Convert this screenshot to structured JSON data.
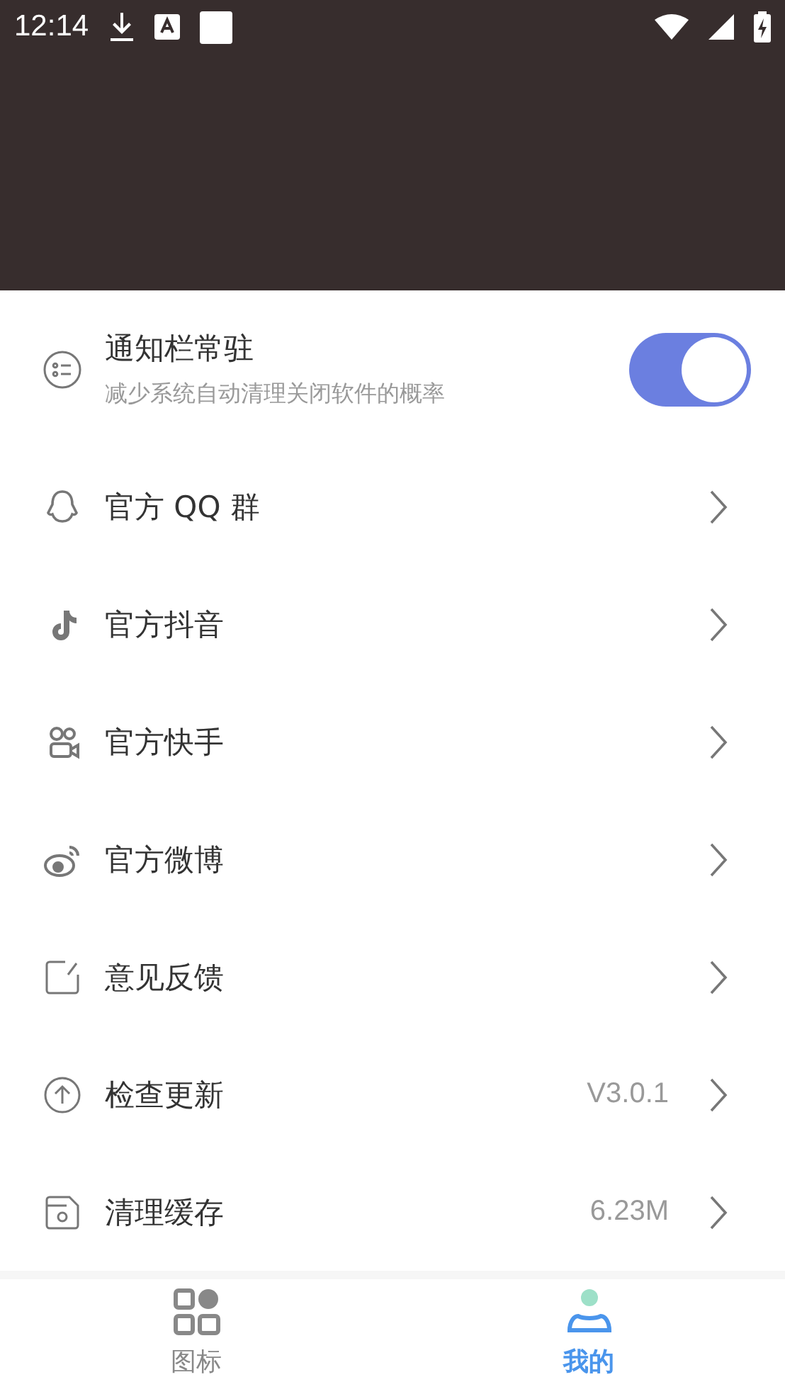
{
  "status_bar": {
    "time": "12:14"
  },
  "notification_setting": {
    "title": "通知栏常驻",
    "subtitle": "减少系统自动清理关闭软件的概率",
    "on": true
  },
  "menu_items": [
    {
      "label": "官方 QQ 群"
    },
    {
      "label": "官方抖音"
    },
    {
      "label": "官方快手"
    },
    {
      "label": "官方微博"
    },
    {
      "label": "意见反馈"
    },
    {
      "label": "检查更新",
      "value": "V3.0.1"
    },
    {
      "label": "清理缓存",
      "value": "6.23M"
    }
  ],
  "bottom_nav": [
    {
      "label": "图标",
      "selected": false
    },
    {
      "label": "我的",
      "selected": true
    }
  ]
}
